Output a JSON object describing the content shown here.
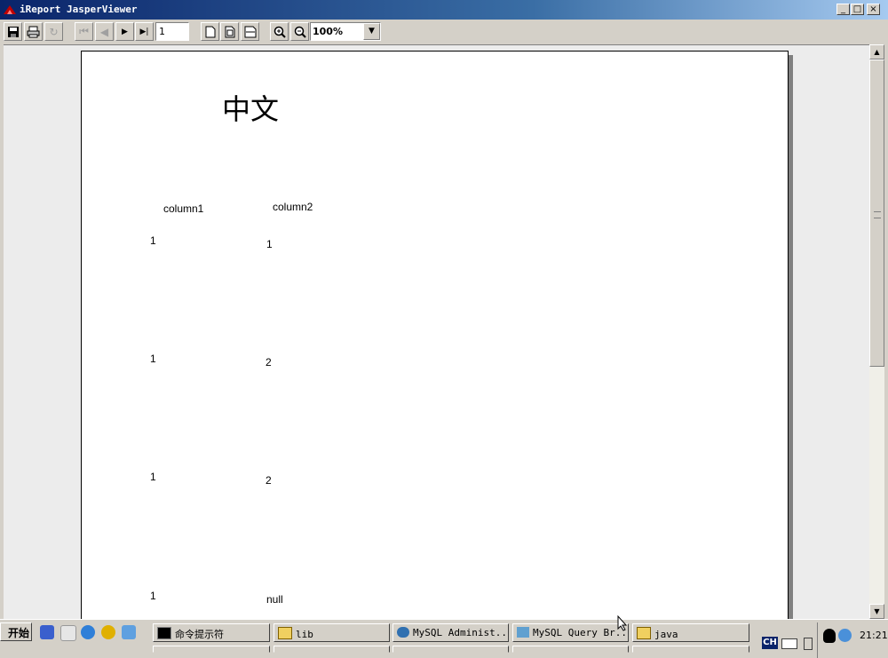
{
  "window": {
    "title": "iReport JasperViewer"
  },
  "toolbar": {
    "page_number": "1",
    "zoom": "100%"
  },
  "report": {
    "title": "中文",
    "headers": [
      "column1",
      "column2"
    ],
    "rows": [
      [
        "1",
        "1"
      ],
      [
        "1",
        "2"
      ],
      [
        "1",
        "2"
      ],
      [
        "1",
        "null"
      ]
    ]
  },
  "taskbar": {
    "start_label": "开始",
    "tasks": [
      {
        "label": "命令提示符",
        "icon": "cmd-icon"
      },
      {
        "label": "lib",
        "icon": "folder-icon"
      },
      {
        "label": "MySQL Administ...",
        "icon": "mysql-admin-icon"
      },
      {
        "label": "MySQL Query Br...",
        "icon": "mysql-query-icon"
      },
      {
        "label": "java",
        "icon": "folder-icon"
      }
    ],
    "ime": "CH",
    "clock": "21:21"
  },
  "colors": {
    "titlebar_start": "#0a246a",
    "titlebar_end": "#a6caf0",
    "desktop": "#d4d0c8"
  }
}
